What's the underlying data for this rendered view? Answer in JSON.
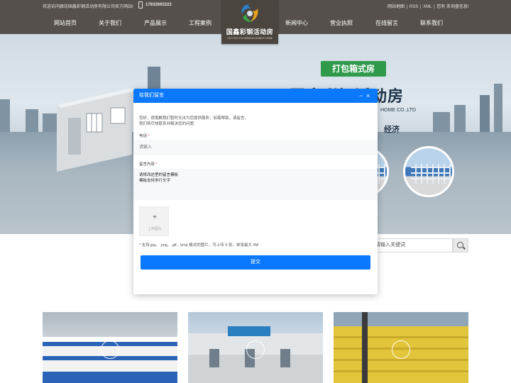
{
  "topbar": {
    "welcome": "欢迎访问廊坊国鑫彩钢活动房有限公司官方网站!",
    "phone": "17832665222",
    "links": [
      "网站地图",
      "RSS",
      "XML",
      "您有",
      "条询盘信息!"
    ],
    "link_sep": "|"
  },
  "nav": {
    "items": [
      "网站首页",
      "关于我们",
      "产品展示",
      "工程案例",
      "新闻中心",
      "营业执照",
      "在线留言",
      "联系我们"
    ]
  },
  "logo": {
    "cn": "国鑫彩钢活动房",
    "en": "GUO XIN COLORBOND MOBILE HOME"
  },
  "banner": {
    "badge": "打包箱式房",
    "title": "国鑫彩钢活动房",
    "en": "HOME CO.,LTD",
    "slogan": "经济"
  },
  "search": {
    "placeholder": "请输入关键词"
  },
  "dialog": {
    "title": "给我们留言",
    "minimize": "−",
    "close": "×",
    "intro": [
      "您好，很抱歉我们暂时无法为您提供服务，如需帮助，请留言，",
      "我们将尽快联系并解决您的问题"
    ],
    "phone_label": "电话",
    "required_mark": "*",
    "phone_placeholder": "请输入",
    "message_label": "留言内容",
    "message_lines": [
      "请修改这里的留言模板",
      "模板支持多行文字"
    ],
    "upload_plus": "+",
    "upload_label": "上传图片",
    "upload_hint": "* 支持.jpg、.png、.gif、bmp 格式的图片，可上传 5 张，单张最大 5M",
    "submit": "提交"
  },
  "colors": {
    "header_bg": "#55504b",
    "dialog_accent": "#0a78ff",
    "badge_green": "#2e9a4a"
  }
}
